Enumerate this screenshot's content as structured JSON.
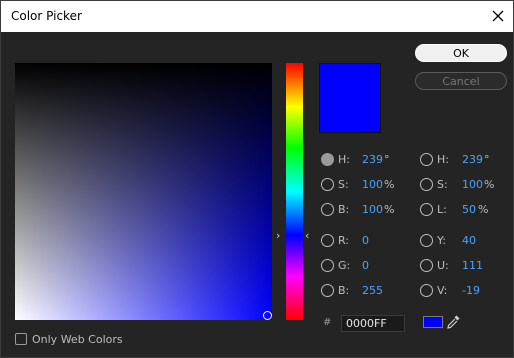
{
  "window": {
    "title": "Color Picker"
  },
  "buttons": {
    "ok": "OK",
    "cancel": "Cancel"
  },
  "current_color": "#0000ff",
  "left_fields": {
    "h": {
      "label": "H:",
      "value": "239",
      "unit": "°"
    },
    "s": {
      "label": "S:",
      "value": "100",
      "unit": "%"
    },
    "b": {
      "label": "B:",
      "value": "100",
      "unit": "%"
    },
    "r": {
      "label": "R:",
      "value": "0"
    },
    "g": {
      "label": "G:",
      "value": "0"
    },
    "b2": {
      "label": "B:",
      "value": "255"
    }
  },
  "right_fields": {
    "h": {
      "label": "H:",
      "value": "239",
      "unit": "°"
    },
    "s": {
      "label": "S:",
      "value": "100",
      "unit": "%"
    },
    "l": {
      "label": "L:",
      "value": "50",
      "unit": "%"
    },
    "y": {
      "label": "Y:",
      "value": "40"
    },
    "u": {
      "label": "U:",
      "value": "111"
    },
    "v": {
      "label": "V:",
      "value": "-19"
    }
  },
  "hex": {
    "label": "#",
    "value": "0000FF"
  },
  "web_colors": {
    "label": "Only Web Colors",
    "checked": false
  },
  "icons": {
    "close": "close-icon",
    "eyedropper": "eyedropper-icon"
  }
}
